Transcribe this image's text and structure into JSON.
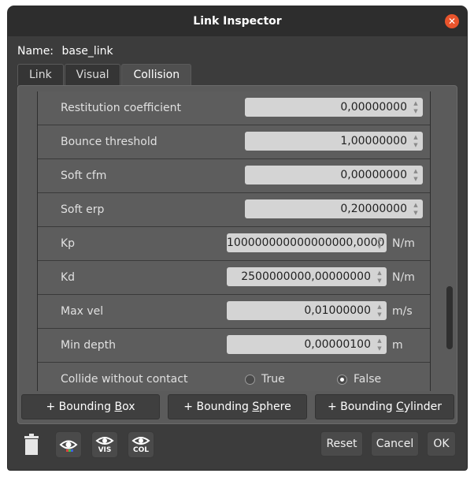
{
  "window": {
    "title": "Link Inspector"
  },
  "name_label": "Name:",
  "name_value": "base_link",
  "tabs": [
    {
      "label": "Link",
      "active": false
    },
    {
      "label": "Visual",
      "active": false
    },
    {
      "label": "Collision",
      "active": true
    }
  ],
  "properties": [
    {
      "label": "Restitution coefficient",
      "value": "0,00000000",
      "unit": ""
    },
    {
      "label": "Bounce threshold",
      "value": "1,00000000",
      "unit": ""
    },
    {
      "label": "Soft cfm",
      "value": "0,00000000",
      "unit": ""
    },
    {
      "label": "Soft erp",
      "value": "0,20000000",
      "unit": ""
    },
    {
      "label": "Kp",
      "value": "100000000000000000,0000",
      "unit": "N/m"
    },
    {
      "label": "Kd",
      "value": "2500000000,00000000",
      "unit": "N/m"
    },
    {
      "label": "Max vel",
      "value": "0,01000000",
      "unit": "m/s"
    },
    {
      "label": "Min depth",
      "value": "0,00000100",
      "unit": "m"
    }
  ],
  "collide_row": {
    "label": "Collide without contact",
    "true_label": "True",
    "false_label": "False",
    "selected": "False"
  },
  "geometry_buttons": {
    "box_prefix": "+ Bounding ",
    "box_key": "B",
    "box_suffix": "ox",
    "sphere_prefix": "+ Bounding ",
    "sphere_key": "S",
    "sphere_suffix": "phere",
    "cylinder_prefix": "+ Bounding ",
    "cylinder_key": "C",
    "cylinder_suffix": "ylinder"
  },
  "toolbar": {
    "vis_label": "VIS",
    "col_label": "COL"
  },
  "dialog_buttons": {
    "reset": "Reset",
    "cancel": "Cancel",
    "ok": "OK"
  },
  "colors": {
    "accent_close": "#e9542c",
    "window_bg": "#3c3c3c",
    "field_bg": "#d4d4d4"
  }
}
